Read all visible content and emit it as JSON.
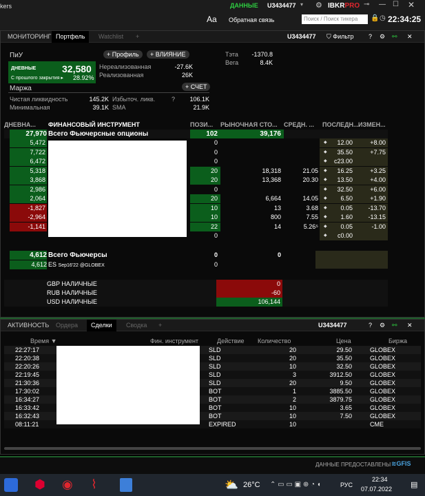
{
  "topbar": {
    "title_fragment": "kers",
    "data_label": "ДАННЫЕ",
    "account": "U3434477",
    "brand_a": "IBKR",
    "brand_b": "PRO",
    "font_btn": "Aa",
    "feedback": "Обратная связь",
    "search_placeholder": "Поиск / Поиск тикера",
    "clock": "22:34:25"
  },
  "portfolio_panel": {
    "tabs": [
      "МОНИТОРИНГ",
      "Портфель",
      "Watchlist",
      "+"
    ],
    "account": "U3434477",
    "filter_label": "Фильтр",
    "pnl": {
      "title": "ПиУ",
      "profile_btn": "Профиль",
      "impact_btn": "ВЛИЯНИЕ",
      "daily_label": "ДНЕВНЫЕ",
      "daily_value": "32,580",
      "since_close_label": "С прошлого закрытия",
      "since_close_pct": "28.92%",
      "unrealized_label": "Нереализованная",
      "unrealized_value": "-27.6K",
      "realized_label": "Реализованная",
      "realized_value": "26K",
      "theta_label": "Тэта",
      "theta_value": "-1370.8",
      "vega_label": "Вега",
      "vega_value": "8.4K"
    },
    "margin": {
      "title": "Маржа",
      "account_btn": "СЧЕТ",
      "net_liq_label": "Чистая ликвидность",
      "net_liq_value": "145.2K",
      "excess_label": "Избыточ. ликв.",
      "excess_value": "106.1K",
      "min_label": "Минимальная",
      "min_value": "39.1K",
      "sma_label": "SMA",
      "sma_value": "21.9K",
      "q": "?"
    },
    "headers": {
      "daily": "ДНЕВНА...",
      "instrument": "ФИНАНСОВЫЙ ИНСТРУМЕНТ",
      "position": "ПОЗИ...",
      "market": "РЫНОЧНАЯ СТО...",
      "avg": "СРЕДН. ...",
      "last": "ПОСЛЕДН...",
      "change": "ИЗМЕН..."
    },
    "group_opts": {
      "daily": "27,970",
      "name": "Всего Фьючерсные опционы",
      "pos": "102",
      "mkt": "39,176"
    },
    "rows": [
      {
        "daily": "5,472",
        "pos": "0",
        "mkt": "",
        "avg": "",
        "last": "12.00",
        "chg": "+8.00"
      },
      {
        "daily": "7,722",
        "pos": "0",
        "mkt": "",
        "avg": "",
        "last": "35.50",
        "chg": "+7.75"
      },
      {
        "daily": "6,472",
        "pos": "0",
        "mkt": "",
        "avg": "",
        "last": "c23.00",
        "chg": ""
      },
      {
        "daily": "5,318",
        "pos": "20",
        "mkt": "18,318",
        "avg": "21.05",
        "last": "16.25",
        "chg": "+3.25"
      },
      {
        "daily": "3,868",
        "pos": "20",
        "mkt": "13,368",
        "avg": "20.30",
        "last": "13.50",
        "chg": "+4.00"
      },
      {
        "daily": "2,986",
        "pos": "0",
        "mkt": "",
        "avg": "",
        "last": "32.50",
        "chg": "+6.00"
      },
      {
        "daily": "2,064",
        "pos": "20",
        "mkt": "6,664",
        "avg": "14.05",
        "last": "6.50",
        "chg": "+1.90"
      },
      {
        "daily": "-1,827",
        "pos": "10",
        "mkt": "13",
        "avg": "3.68",
        "last": "0.05",
        "chg": "-13.70"
      },
      {
        "daily": "-2,964",
        "pos": "10",
        "mkt": "800",
        "avg": "7.55",
        "last": "1.60",
        "chg": "-13.15"
      },
      {
        "daily": "-1,141",
        "pos": "22",
        "mkt": "14",
        "avg": "5.26⁵",
        "last": "0.05",
        "chg": "-1.00"
      },
      {
        "daily": "",
        "pos": "0",
        "mkt": "",
        "avg": "",
        "last": "c0.00",
        "chg": ""
      }
    ],
    "group_fut": {
      "daily": "4,612",
      "name": "Всего Фьючерсы",
      "pos": "0",
      "mkt": "0"
    },
    "fut_row": {
      "daily": "4,612",
      "sym": "ES",
      "exp": "Sep16'22 @GLOBEX",
      "pos": "0"
    },
    "cash": [
      {
        "label": "GBP НАЛИЧНЫЕ",
        "value": "0"
      },
      {
        "label": "RUB НАЛИЧНЫЕ",
        "value": "-60"
      },
      {
        "label": "USD НАЛИЧНЫЕ",
        "value": "106,144"
      }
    ]
  },
  "trades_panel": {
    "tabs": [
      "АКТИВНОСТЬ",
      "Ордера",
      "Сделки",
      "Сводка",
      "+"
    ],
    "account": "U3434477",
    "headers": {
      "time": "Время",
      "instrument": "Фин. инструмент",
      "action": "Действие",
      "qty": "Количество",
      "price": "Цена",
      "exchange": "Биржа"
    },
    "rows": [
      {
        "time": "22:27:17",
        "action": "SLD",
        "qty": "20",
        "price": "29.50",
        "exch": "GLOBEX"
      },
      {
        "time": "22:20:38",
        "action": "SLD",
        "qty": "20",
        "price": "35.50",
        "exch": "GLOBEX"
      },
      {
        "time": "22:20:26",
        "action": "SLD",
        "qty": "10",
        "price": "32.50",
        "exch": "GLOBEX"
      },
      {
        "time": "22:19:45",
        "action": "SLD",
        "qty": "3",
        "price": "3912.50",
        "exch": "GLOBEX"
      },
      {
        "time": "21:30:36",
        "action": "SLD",
        "qty": "20",
        "price": "9.50",
        "exch": "GLOBEX"
      },
      {
        "time": "17:30:02",
        "action": "BOT",
        "qty": "1",
        "price": "3885.50",
        "exch": "GLOBEX"
      },
      {
        "time": "16:34:27",
        "action": "BOT",
        "qty": "2",
        "price": "3879.75",
        "exch": "GLOBEX"
      },
      {
        "time": "16:33:42",
        "action": "BOT",
        "qty": "10",
        "price": "3.65",
        "exch": "GLOBEX"
      },
      {
        "time": "16:32:43",
        "action": "BOT",
        "qty": "10",
        "price": "7.50",
        "exch": "GLOBEX"
      },
      {
        "time": "08:11:21",
        "action": "EXPIRED",
        "qty": "10",
        "price": "",
        "exch": "CME"
      }
    ]
  },
  "footer": {
    "provided": "ДАННЫЕ ПРЕДОСТАВЛЕНЫ",
    "gfis": "GFIS"
  },
  "taskbar": {
    "temp": "26°C",
    "lang": "РУС",
    "time": "22:34",
    "date": "07.07.2022"
  },
  "colors": {
    "green": "#2ecc40",
    "dark_green": "#0b5e1c",
    "red": "#8b0a0a",
    "accent": "#d4a017"
  }
}
